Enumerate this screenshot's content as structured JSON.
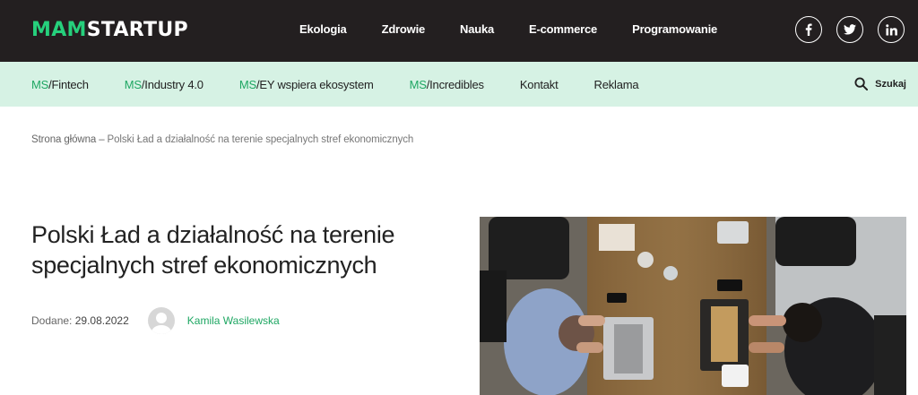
{
  "header": {
    "logo_accent": "MAM",
    "logo_rest": "STARTUP",
    "nav": [
      "Ekologia",
      "Zdrowie",
      "Nauka",
      "E-commerce",
      "Programowanie"
    ],
    "social": [
      "facebook-icon",
      "twitter-icon",
      "linkedin-icon"
    ]
  },
  "subnav": {
    "prefix": "MS",
    "items": [
      {
        "prefix": "MS",
        "label": "/Fintech"
      },
      {
        "prefix": "MS",
        "label": "/Industry 4.0"
      },
      {
        "prefix": "MS",
        "label": "/EY wspiera ekosystem"
      },
      {
        "prefix": "MS",
        "label": "/Incredibles"
      },
      {
        "prefix": "",
        "label": "Kontakt"
      },
      {
        "prefix": "",
        "label": "Reklama"
      }
    ],
    "search_label": "Szukaj"
  },
  "breadcrumb": {
    "home": "Strona główna",
    "separator": "–",
    "current": "Polski Ład a działalność na terenie specjalnych stref ekonomicznych"
  },
  "article": {
    "title": "Polski Ład a działalność na terenie specjalnych stref ekonomicznych",
    "date_label": "Dodane:",
    "date": "29.08.2022",
    "author": "Kamila Wasilewska"
  },
  "colors": {
    "topbar": "#231f20",
    "accent": "#26d07c",
    "subbar": "#d6f2e4"
  }
}
